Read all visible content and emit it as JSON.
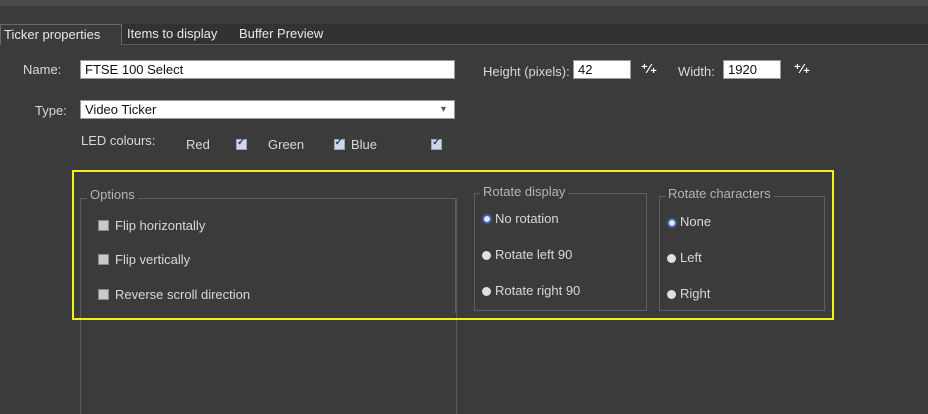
{
  "tabs": [
    {
      "label": "Ticker properties",
      "active": true
    },
    {
      "label": "Items to display",
      "active": false
    },
    {
      "label": "Buffer Preview",
      "active": false
    }
  ],
  "form": {
    "name_label": "Name:",
    "name_value": "FTSE 100 Select",
    "height_label": "Height (pixels):",
    "height_value": "42",
    "width_label": "Width:",
    "width_value": "1920",
    "type_label": "Type:",
    "type_value": "Video Ticker",
    "led_label": "LED colours:",
    "led": [
      {
        "label": "Red",
        "checked": true
      },
      {
        "label": "Green",
        "checked": true
      },
      {
        "label": "Blue",
        "checked": true
      }
    ]
  },
  "options": {
    "title": "Options",
    "items": [
      {
        "label": "Flip horizontally"
      },
      {
        "label": "Flip vertically"
      },
      {
        "label": "Reverse scroll direction"
      }
    ]
  },
  "rotate_display": {
    "title": "Rotate display",
    "items": [
      {
        "label": "No rotation",
        "selected": true
      },
      {
        "label": "Rotate left 90",
        "selected": false
      },
      {
        "label": "Rotate right 90",
        "selected": false
      }
    ]
  },
  "rotate_characters": {
    "title": "Rotate characters",
    "items": [
      {
        "label": "None",
        "selected": true
      },
      {
        "label": "Left",
        "selected": false
      },
      {
        "label": "Right",
        "selected": false
      }
    ]
  },
  "colors": {
    "highlight": "#f2ef1a",
    "background": "#3b3b3b"
  }
}
